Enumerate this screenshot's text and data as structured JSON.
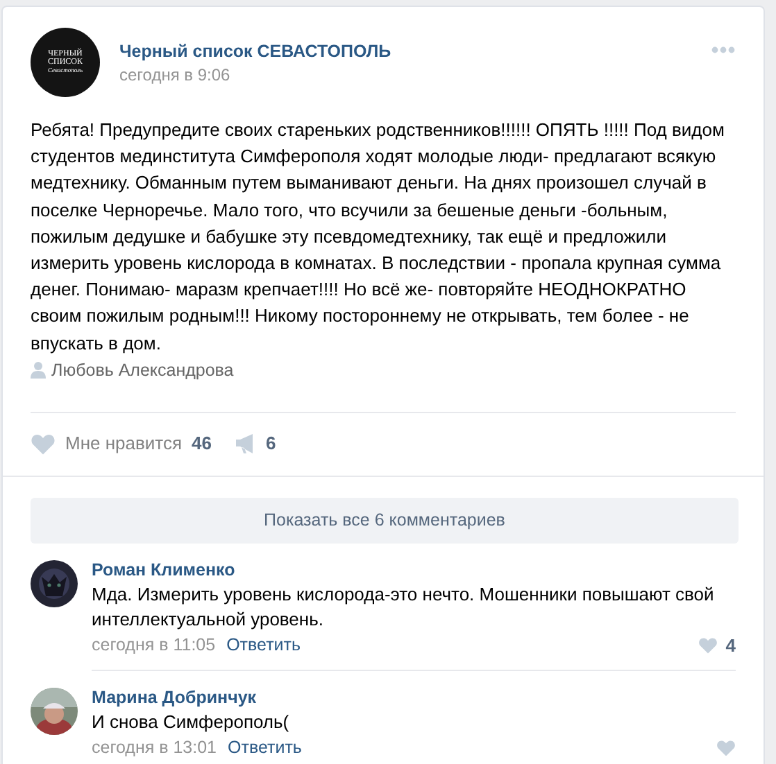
{
  "post": {
    "author": "Черный список СЕВАСТОПОЛЬ",
    "logo_lines": [
      "ЧЕРНЫЙ",
      "СПИСОК",
      "Севастополь"
    ],
    "time": "сегодня в 9:06",
    "text": "Ребята! Предупредите своих стареньких родственников!!!!!! ОПЯТЬ !!!!! Под видом студентов мединститута Симферополя ходят молодые люди- предлагают всякую медтехнику. Обманным путем выманивают деньги. На днях произошел случай в поселке Черноречье. Мало того, что всучили за бешеные деньги -больным, пожилым дедушке и бабушке эту псевдомедтехнику, так ещё и предложили измерить уровень кислорода в комнатах. В последствии - пропала крупная сумма денег. Понимаю- маразм крепчает!!!! Но всё же- повторяйте НЕОДНОКРАТНО своим пожилым родным!!! Никому постороннему не открывать, тем более - не впускать в дом.",
    "signer": "Любовь Александрова",
    "like_label": "Мне нравится",
    "likes": "46",
    "shares": "6"
  },
  "show_all_button": "Показать все 6 комментариев",
  "comments": [
    {
      "author": "Роман Клименко",
      "text": "Мда. Измерить уровень кислорода-это нечто. Мошенники повышают свой интеллектуальной уровень.",
      "time": "сегодня в 11:05",
      "reply": "Ответить",
      "likes": "4"
    },
    {
      "author": "Марина Добринчук",
      "text": "И снова Симферополь(",
      "time": "сегодня в 13:01",
      "reply": "Ответить"
    }
  ]
}
